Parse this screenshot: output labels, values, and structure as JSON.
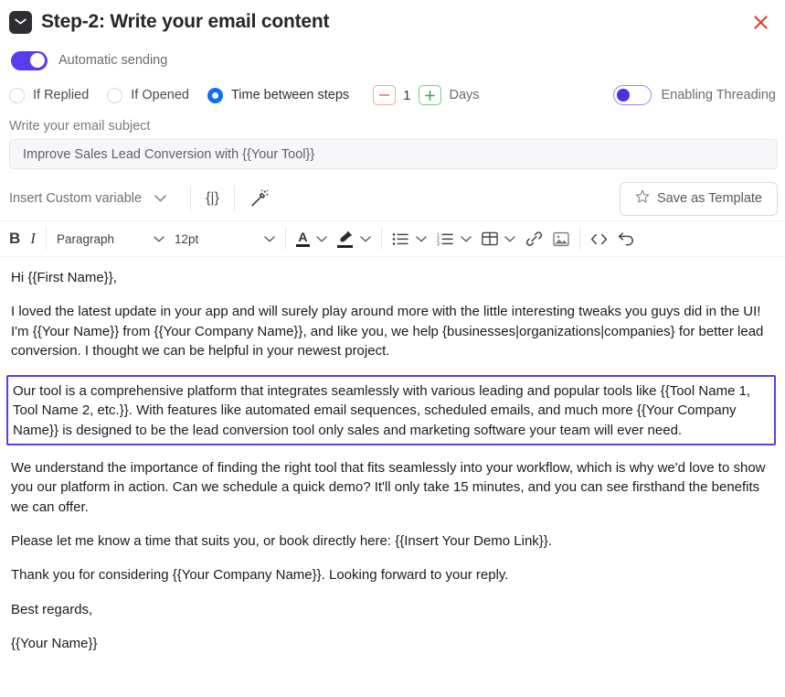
{
  "header": {
    "icon": "envelope-icon",
    "title": "Step-2: Write your email content",
    "close_icon": "close-icon"
  },
  "automatic_sending": {
    "label": "Automatic sending",
    "enabled": true,
    "accent_color": "#5b3bef"
  },
  "trigger_options": [
    {
      "label": "If Replied",
      "selected": false
    },
    {
      "label": "If Opened",
      "selected": false
    },
    {
      "label": "Time between steps",
      "selected": true
    }
  ],
  "delay_stepper": {
    "minus_label": "−",
    "value": "1",
    "plus_label": "+",
    "unit": "Days",
    "minus_color": "#ef6b62",
    "plus_color": "#3faa5a"
  },
  "threading": {
    "label": "Enabling Threading",
    "enabled": false,
    "accent_color": "#4b2fe0"
  },
  "subject": {
    "label": "Write your email subject",
    "value": "Improve Sales Lead Conversion with {{Your Tool}}",
    "placeholder": "Write your email subject"
  },
  "variable_toolbar": {
    "insert_variable_label": "Insert Custom variable",
    "chevron_icon": "chevron-down-icon",
    "brace_icon": "{|}",
    "wand_icon": "magic-wand-icon",
    "save_template_label": "Save as Template",
    "star_icon": "star-icon"
  },
  "format_toolbar": {
    "bold_label": "B",
    "italic_label": "I",
    "block_format": "Paragraph",
    "font_size": "12pt",
    "font_color_glyph": "A",
    "icons": [
      "font-color-icon",
      "highlight-color-icon",
      "bullet-list-icon",
      "numbered-list-icon",
      "table-icon",
      "link-icon",
      "image-icon",
      "code-icon",
      "undo-icon"
    ]
  },
  "email_body": {
    "paragraphs": [
      "Hi {{First Name}},",
      "I loved the latest update in your app and will surely play around more with the little interesting tweaks you guys did in the UI! I'm {{Your Name}} from {{Your Company Name}}, and like you, we help {businesses|organizations|companies} for better lead conversion. I thought we can be helpful in your newest project.",
      "We understand the importance of finding the right tool that fits seamlessly into your workflow, which is why we'd love to show you our platform in action. Can we schedule a quick demo? It'll only take 15 minutes, and you can see firsthand the benefits we can offer.",
      "Please let me know a time that suits you, or book directly here: {{Insert Your Demo Link}}.",
      "Thank you for considering {{Your Company Name}}. Looking forward to your reply.",
      "Best regards,",
      "{{Your Name}}"
    ],
    "highlighted_paragraph": "Our tool is a comprehensive platform that integrates seamlessly with various leading and popular tools like {{Tool Name 1, Tool Name 2, etc.}}. With features like automated email sequences, scheduled emails, and much more {{Your Company Name}} is designed to be the lead conversion tool only sales and marketing software your team will ever need.",
    "highlight_border_color": "#5b3bef"
  }
}
